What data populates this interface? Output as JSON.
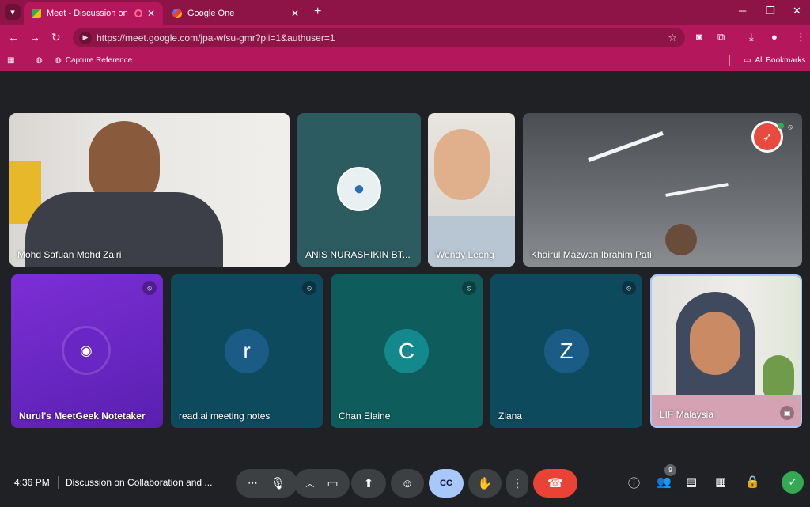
{
  "browser": {
    "tabs": [
      {
        "label": "Meet - Discussion on Collab",
        "active": true
      },
      {
        "label": "Google One",
        "active": false
      }
    ],
    "url": "https://meet.google.com/jpa-wfsu-gmr?pli=1&authuser=1",
    "bookmarks": {
      "capture": "Capture Reference",
      "all": "All Bookmarks"
    }
  },
  "participants": [
    {
      "name": "Mohd Safuan Mohd Zairi",
      "type": "video"
    },
    {
      "name": "ANIS NURASHIKIN BT...",
      "type": "avatar"
    },
    {
      "name": "Wendy Leong",
      "type": "video"
    },
    {
      "name": "Khairul Mazwan Ibrahim Pati",
      "type": "video"
    },
    {
      "name": "Nurul's MeetGeek Notetaker",
      "type": "bot",
      "muted": true
    },
    {
      "name": "read.ai meeting notes",
      "type": "initial",
      "initial": "r",
      "muted": true
    },
    {
      "name": "Chan Elaine",
      "type": "initial",
      "initial": "C",
      "muted": true
    },
    {
      "name": "Ziana",
      "type": "initial",
      "initial": "Z",
      "muted": true
    },
    {
      "name": "LIF Malaysia",
      "type": "video"
    }
  ],
  "controls": {
    "time": "4:36 PM",
    "meeting_title": "Discussion on Collaboration and ...",
    "people_count": "9"
  },
  "colors": {
    "tab_bar": "#8e1447",
    "toolbar": "#b5175d",
    "stage": "#202124",
    "end_call": "#ea4335",
    "captions_active": "#a8c7fa"
  }
}
